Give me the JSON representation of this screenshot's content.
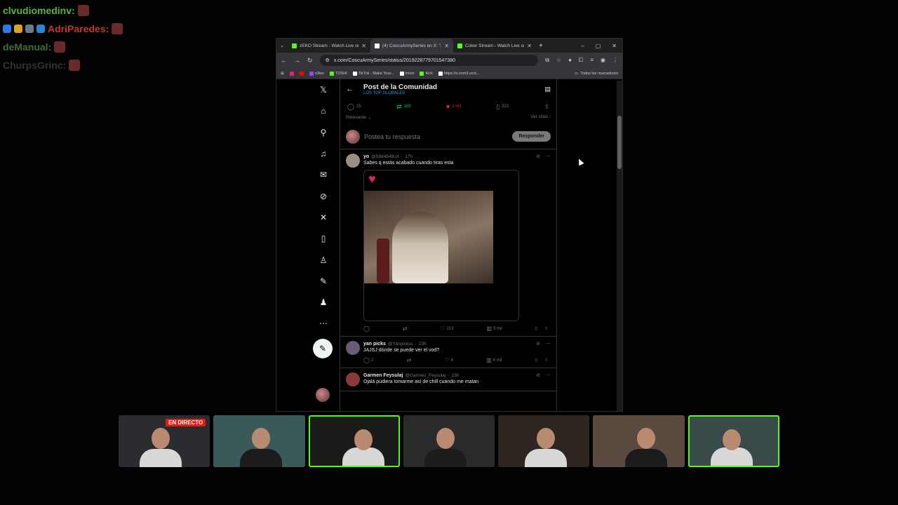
{
  "chat": [
    {
      "user": "clvudiomedinv:",
      "color": "#5ab33d",
      "badges": []
    },
    {
      "user": "AdriParedes:",
      "color": "#c0392b",
      "badges": [
        "#2f7be5",
        "#d8a326",
        "#6a7b8a",
        "#2a86d6"
      ]
    },
    {
      "user": "deManual:",
      "color": "#3f6e34",
      "badges": []
    },
    {
      "user": "ChurpsGrinc:",
      "color": "#333333",
      "badges": []
    }
  ],
  "browser": {
    "tabs": [
      {
        "title": "zEKO Stream - Watch Live on K",
        "favicon": "#53fc18",
        "active": false
      },
      {
        "title": "(4) CoscuArmySeries en X: \"JA",
        "favicon": "#ffffff",
        "active": true
      },
      {
        "title": "Coker Stream - Watch Live on",
        "favicon": "#53fc18",
        "active": false
      }
    ],
    "url": "x.com/CoscuArmySeries/status/2019228779701547380",
    "bookmarks": [
      {
        "label": "",
        "color": "#d62976"
      },
      {
        "label": "",
        "color": "#ff0000"
      },
      {
        "label": "c0ker",
        "color": "#9146ff"
      },
      {
        "label": "TOSHI",
        "color": "#53fc18"
      },
      {
        "label": "TikTok - Make Your...",
        "color": "#ffffff"
      },
      {
        "label": "Inicio",
        "color": "#ffffff"
      },
      {
        "label": "Kick",
        "color": "#53fc18"
      },
      {
        "label": "https://x.com/Lucct...",
        "color": "#ffffff"
      }
    ],
    "all_bookmarks": "Todos los marcadores"
  },
  "nav": [
    "x-logo-icon",
    "home-icon",
    "search-icon",
    "notifications-icon",
    "messages-icon",
    "grok-icon",
    "x-premium-icon",
    "bookmarks-icon",
    "jobs-icon",
    "communities-icon",
    "profile-icon",
    "more-icon"
  ],
  "post": {
    "title": "Post de la Comunidad",
    "community": "LOS TOP GLOBALES",
    "counts": {
      "replies": "25",
      "reposts": "169",
      "likes": "1 mil",
      "bookmarks": "322"
    },
    "sort": "Relevante",
    "quotes": "Ver citas",
    "reply_placeholder": "Postea tu respuesta",
    "reply_button": "Responder"
  },
  "replies": [
    {
      "name": "yo",
      "handle": "@5884848oX",
      "time": "17h",
      "text": "Sabes q estás acabado cuando tiras esta",
      "avatar": "#9a8f85",
      "has_media": true,
      "counts": {
        "replies": "",
        "reposts": "",
        "likes": "213",
        "views": "5 mil"
      }
    },
    {
      "name": "yan picks",
      "handle": "@Yanpickss",
      "time": "23h",
      "text": "JAJSJ dónde se puede ver el vod?",
      "avatar": "#6a5a7a",
      "has_media": false,
      "counts": {
        "replies": "2",
        "reposts": "",
        "likes": "6",
        "views": "6 mil"
      }
    },
    {
      "name": "Garmen Feysulaj",
      "handle": "@Garmen_Feysulaj",
      "time": "23h",
      "text": "Ojalá pudiera tomarme así de chill cuando me matan",
      "avatar": "#8a3a3a",
      "has_media": false,
      "counts": {
        "replies": "",
        "reposts": "",
        "likes": "",
        "views": ""
      }
    }
  ],
  "cams": [
    {
      "bg": "#2a2c30",
      "live": "EN DIRECTO",
      "selected": false
    },
    {
      "bg": "#3a5a5a",
      "live": "",
      "selected": false
    },
    {
      "bg": "#1a1a1a",
      "live": "",
      "selected": true
    },
    {
      "bg": "#2a2a2a",
      "live": "",
      "selected": false
    },
    {
      "bg": "#2e2420",
      "live": "",
      "selected": false
    },
    {
      "bg": "#5a4a40",
      "live": "",
      "selected": false
    },
    {
      "bg": "#3a4a4a",
      "live": "",
      "selected": true
    }
  ]
}
